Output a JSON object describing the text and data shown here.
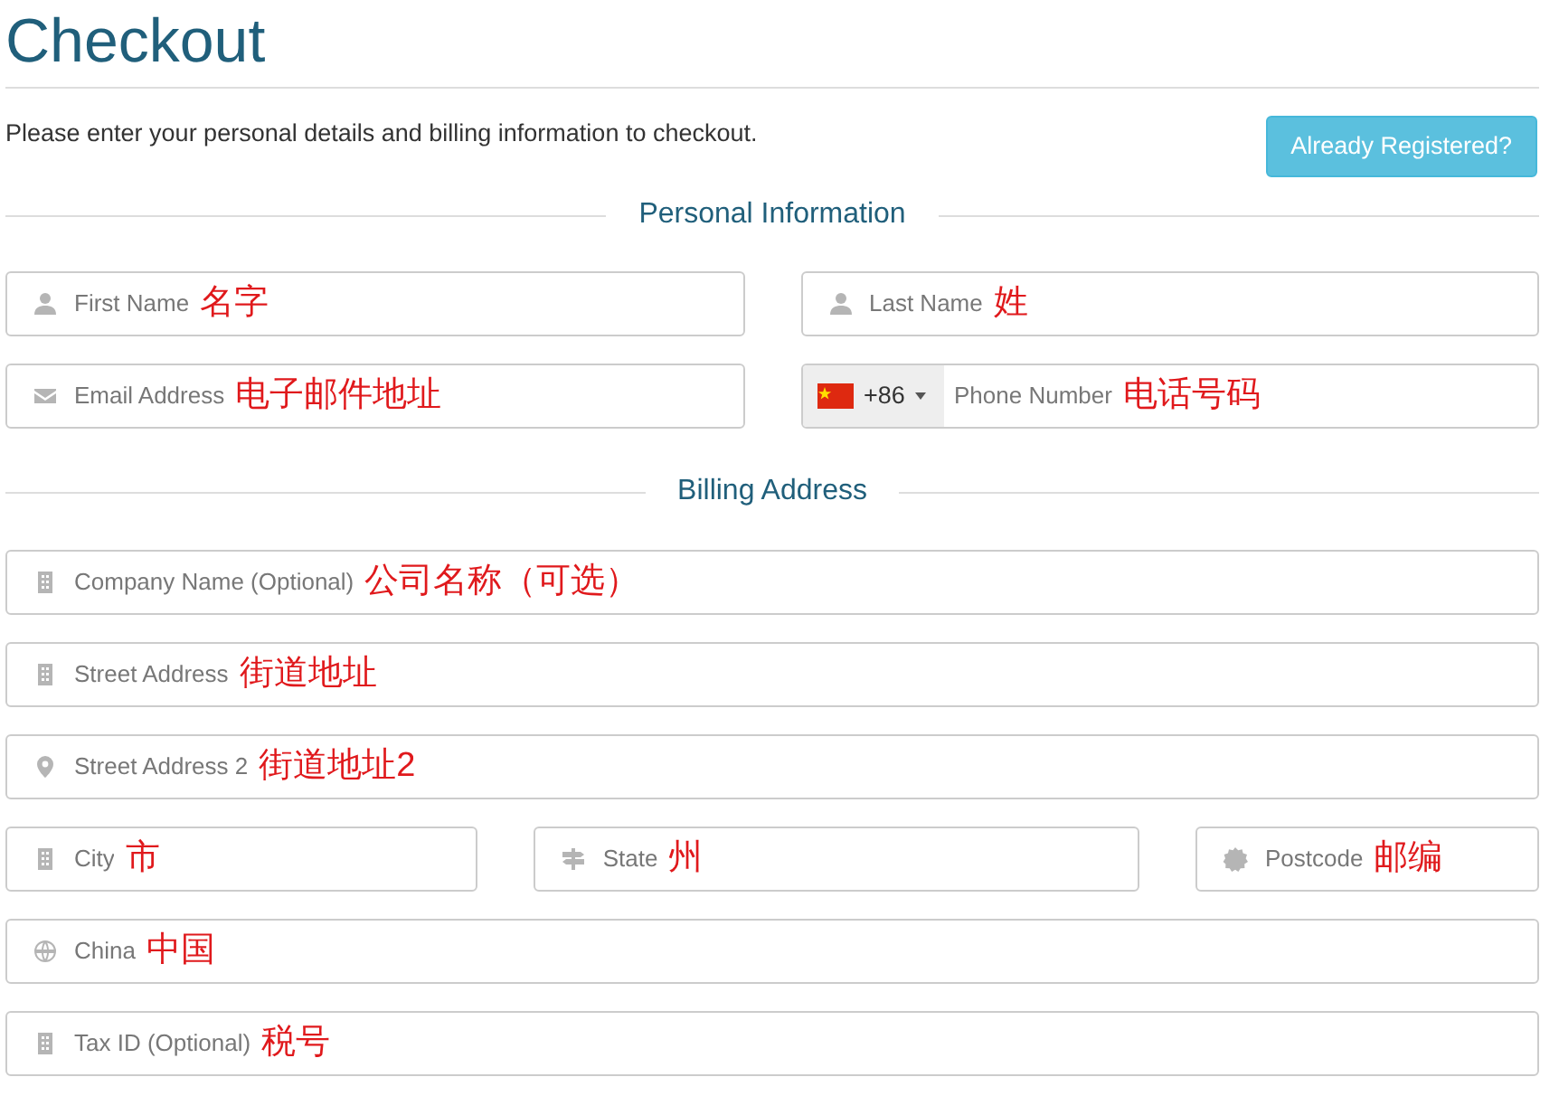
{
  "title": "Checkout",
  "intro": "Please enter your personal details and billing information to checkout.",
  "already_registered_button": "Already Registered?",
  "sections": [
    {
      "heading": "Personal Information",
      "rows": [
        [
          {
            "kind": "person",
            "placeholder": "First Name",
            "annotation": "名字"
          },
          {
            "kind": "person",
            "placeholder": "Last Name",
            "annotation": "姓"
          }
        ],
        [
          {
            "kind": "envelope",
            "placeholder": "Email Address",
            "annotation": "电子邮件地址"
          },
          {
            "kind": "phone",
            "country_code": "+86",
            "placeholder": "Phone Number",
            "annotation": "电话号码"
          }
        ]
      ]
    },
    {
      "heading": "Billing Address",
      "rows": [
        [
          {
            "kind": "building",
            "placeholder": "Company Name (Optional)",
            "annotation": "公司名称（可选）"
          }
        ],
        [
          {
            "kind": "building",
            "placeholder": "Street Address",
            "annotation": "街道地址"
          }
        ],
        [
          {
            "kind": "pin",
            "placeholder": "Street Address 2",
            "annotation": "街道地址2"
          }
        ],
        [
          {
            "kind": "building",
            "placeholder": "City",
            "annotation": "市"
          },
          {
            "kind": "signpost",
            "placeholder": "State",
            "annotation": "州"
          },
          {
            "kind": "badge",
            "placeholder": "Postcode",
            "annotation": "邮编"
          }
        ],
        [
          {
            "kind": "globe",
            "placeholder": "China",
            "annotation": "中国"
          }
        ],
        [
          {
            "kind": "building",
            "placeholder": "Tax ID (Optional)",
            "annotation": "税号"
          }
        ]
      ]
    }
  ]
}
